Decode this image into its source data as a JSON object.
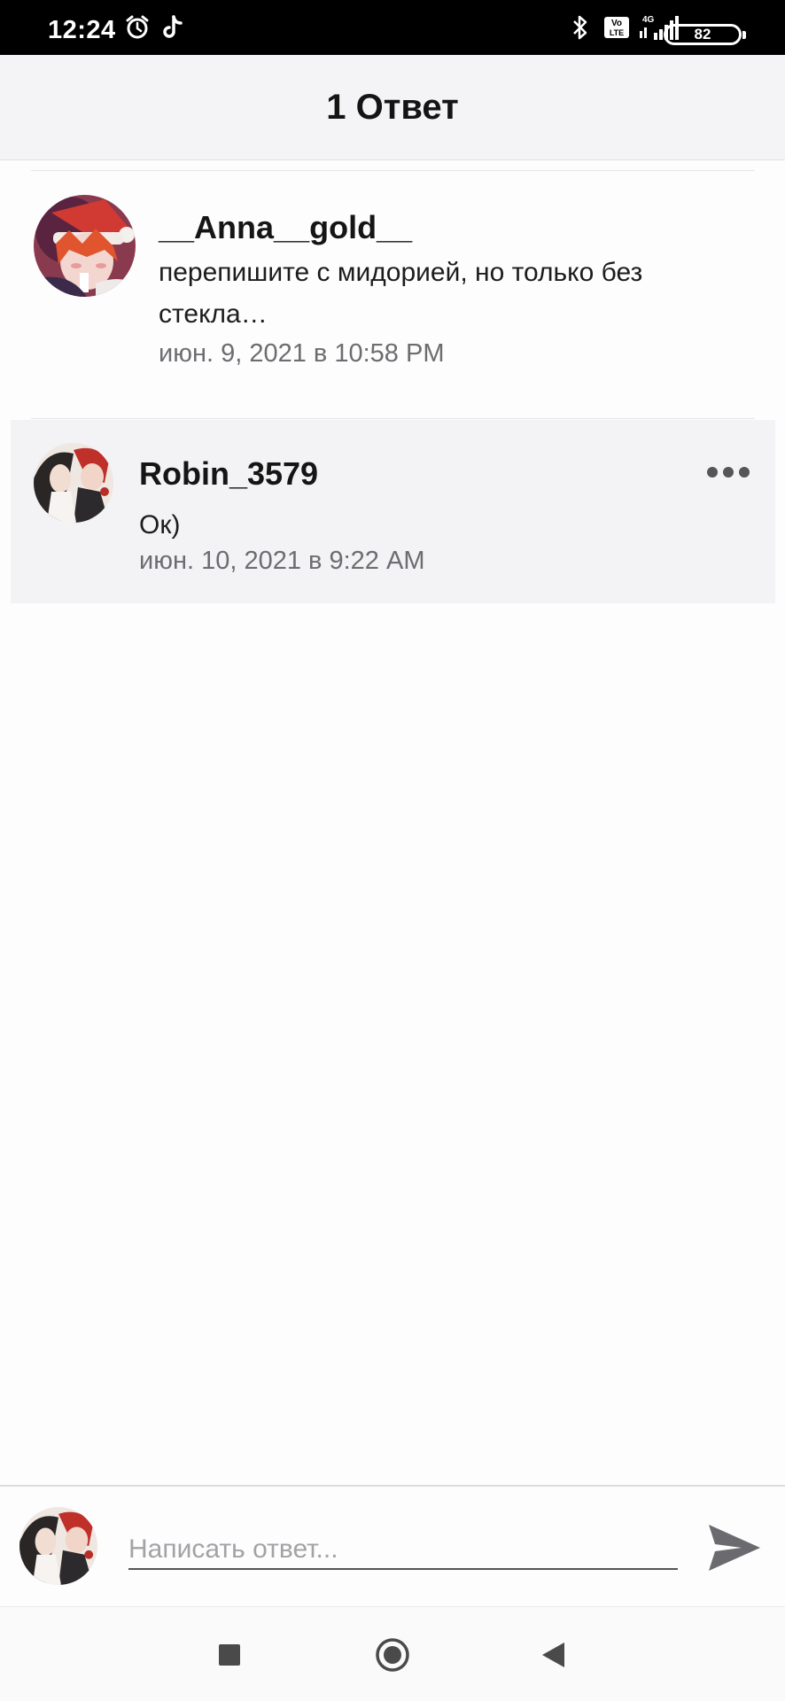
{
  "status_bar": {
    "time": "12:24",
    "icons": [
      "alarm-icon",
      "tiktok-icon",
      "bluetooth-icon",
      "volte-icon",
      "signal-4g-icon"
    ],
    "network": "4G",
    "volte_label": "Vo\nLTE",
    "battery": "82"
  },
  "header": {
    "title": "1 Ответ"
  },
  "comments": [
    {
      "username": "__Anna__gold__",
      "text": "перепишите с мидорией, но только без стекла…",
      "timestamp": "июн. 9, 2021 в 10:58 PM",
      "avatar": "avatar-anna"
    },
    {
      "username": "Robin_3579",
      "text": "Ок)",
      "timestamp": "июн. 10, 2021 в 9:22 AM",
      "avatar": "avatar-robin"
    }
  ],
  "composer": {
    "placeholder": "Написать ответ...",
    "send_icon": "send-icon"
  },
  "colors": {
    "header_bg": "#f4f3f5",
    "reply_bg": "#f3f2f4",
    "timestamp": "#6d6c70",
    "send_icon": "#6b6b6f"
  }
}
